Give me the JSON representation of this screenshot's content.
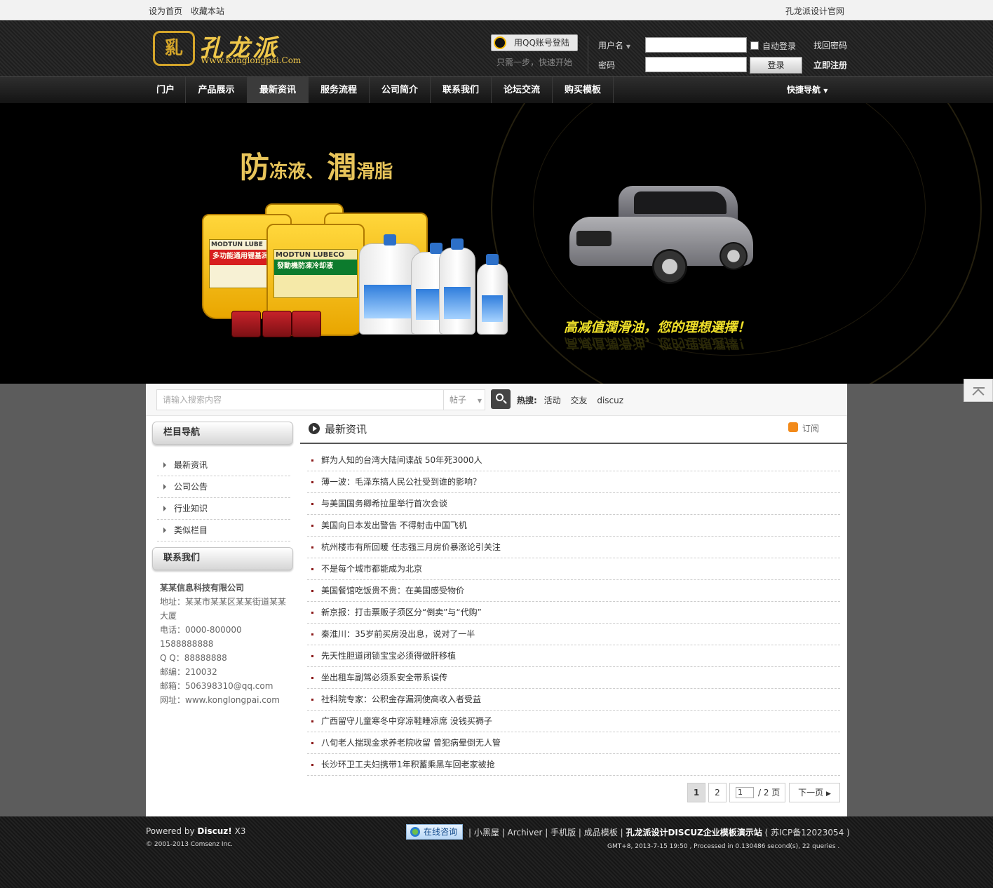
{
  "topbar": {
    "set_home": "设为首页",
    "bookmark": "收藏本站",
    "official": "孔龙派设计官网"
  },
  "header": {
    "logo_mark": "乿",
    "logo_name": "孔龙派",
    "logo_url": "Www.Konglongpai.Com",
    "qq_login": "用QQ账号登陆",
    "qq_sub": "只需一步，快速开始",
    "username_label": "用户名",
    "password_label": "密码",
    "auto_login": "自动登录",
    "login_button": "登录",
    "find_password": "找回密码",
    "register": "立即注册"
  },
  "nav": {
    "items": [
      "门户",
      "产品展示",
      "最新资讯",
      "服务流程",
      "公司简介",
      "联系我们",
      "论坛交流",
      "购买模板"
    ],
    "current": "最新资讯",
    "quick": "快捷导航"
  },
  "banner": {
    "headline_1": "防",
    "headline_2": "冻液、",
    "headline_3": "潤",
    "headline_4": "滑脂",
    "bucket_1_label": "MODTUN LUBE",
    "bucket_1_red": "多功能通用锂基润",
    "bucket_2_label": "MODTUN LUBECO",
    "bucket_2_red": "發動機防凍冷却液",
    "slogan": "高减值潤滑油，您的理想選擇！"
  },
  "search": {
    "placeholder": "请输入搜索内容",
    "type": "帖子",
    "hot_label": "热搜:",
    "hot_words": [
      "活动",
      "交友",
      "discuz"
    ]
  },
  "sidebar": {
    "nav_title": "栏目导航",
    "nav_items": [
      "最新资讯",
      "公司公告",
      "行业知识",
      "类似栏目"
    ],
    "contact_title": "联系我们",
    "company": "某某信息科技有限公司",
    "address": "地址：某某市某某区某某街道某某大厦",
    "phone": "电话：0000-800000 1588888888",
    "qq": "Q  Q：88888888",
    "postcode": "邮编：210032",
    "email": "邮箱：506398310@qq.com",
    "website": "网址：www.konglongpai.com"
  },
  "content": {
    "title": "最新资讯",
    "subscribe": "订阅",
    "articles": [
      "鲜为人知的台湾大陆间谍战 50年死3000人",
      "薄一波：毛泽东搞人民公社受到谁的影响？",
      "与美国国务卿希拉里举行首次会谈",
      "美国向日本发出警告 不得射击中国飞机",
      "杭州楼市有所回暖 任志强三月房价暴涨论引关注",
      "不是每个城市都能成为北京",
      "美国餐馆吃饭贵不贵：在美国感受物价",
      "新京报：打击票贩子须区分“倒卖”与“代购”",
      "秦淮川：35岁前买房没出息，说对了一半",
      "先天性胆道闭锁宝宝必须得做肝移植",
      "坐出租车副驾必须系安全带系误传",
      "社科院专家：公积金存漏洞使高收入者受益",
      "广西留守儿童寒冬中穿凉鞋睡凉席 没钱买褥子",
      "八旬老人揣现金求养老院收留 曾犯病晕倒无人管",
      "长沙环卫工夫妇携带1年积蓄乘黑车回老家被抢"
    ]
  },
  "pager": {
    "page_1": "1",
    "page_2": "2",
    "input_value": "1",
    "total": "/ 2 页",
    "next": "下一页"
  },
  "footer": {
    "powered_prefix": "Powered by",
    "powered_brand": "Discuz!",
    "powered_version": "X3",
    "copyright": "© 2001-2013 Comsenz Inc.",
    "online": "在线咨询",
    "links": [
      "小黑屋",
      "Archiver",
      "手机版",
      "成品模板"
    ],
    "site_name": "孔龙派设计DISCUZ企业模板演示站",
    "icp": "( 苏ICP备12023054 )",
    "stats": "GMT+8, 2013-7-15 19:50 , Processed in 0.130486 second(s), 22 queries ."
  },
  "colors": {
    "accent_gold": "#e7c45a",
    "slogan_yellow": "#f0e12a",
    "header_dark": "#1e1e1e",
    "page_bg": "#5c5c5c"
  }
}
